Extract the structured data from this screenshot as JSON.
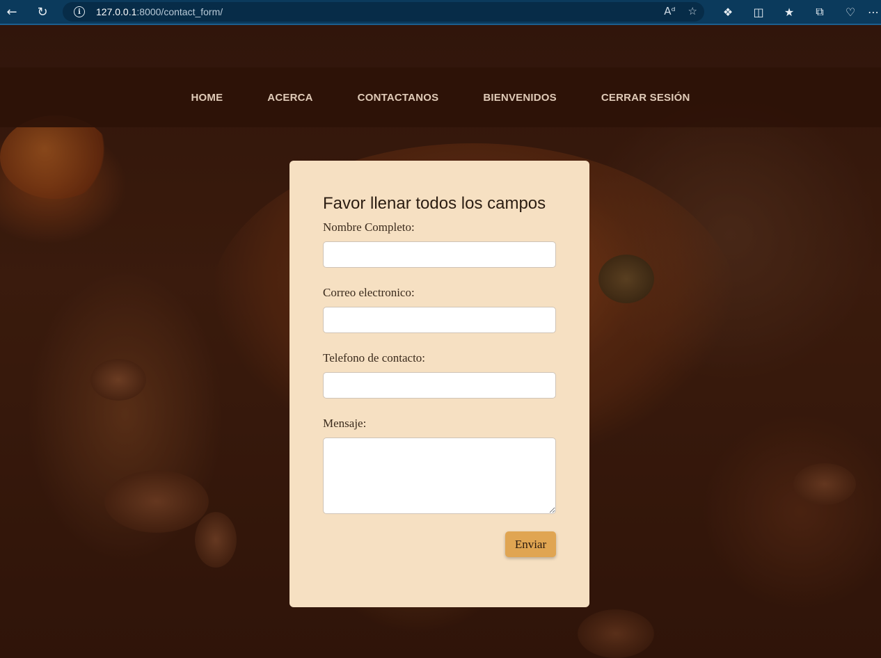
{
  "browser": {
    "url_host": "127.0.0.1",
    "url_rest": ":8000/contact_form/"
  },
  "nav": {
    "items": [
      "HOME",
      "ACERCA",
      "CONTACTANOS",
      "BIENVENIDOS",
      "CERRAR SESIÓN"
    ]
  },
  "form": {
    "title": "Favor llenar todos los campos",
    "name_label": "Nombre Completo:",
    "email_label": "Correo electronico:",
    "phone_label": "Telefono de contacto:",
    "message_label": "Mensaje:",
    "name_value": "",
    "email_value": "",
    "phone_value": "",
    "message_value": "",
    "submit_label": "Enviar"
  },
  "colors": {
    "browser_bar": "#0b3a5c",
    "navbar": "#2d1208",
    "card": "#f6e0c2",
    "button": "#e0a552"
  }
}
